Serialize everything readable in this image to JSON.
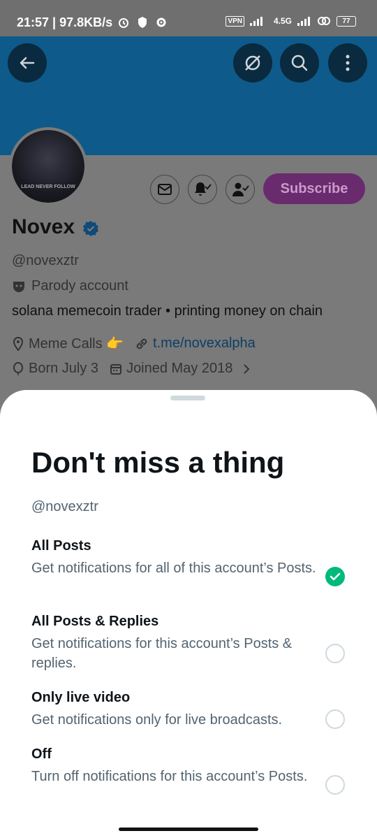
{
  "status_bar": {
    "time_speed": "21:57 | 97.8KB/s",
    "vpn": "VPN",
    "network": "4.5G",
    "battery": "77"
  },
  "header": {
    "icons": [
      "back-arrow-icon",
      "grok-icon",
      "search-icon",
      "more-icon"
    ]
  },
  "profile": {
    "name": "Novex",
    "handle": "@novexztr",
    "label": "Parody account",
    "bio": "solana memecoin trader • printing money on chain",
    "location": "Meme Calls 👉",
    "link": "t.me/novexalpha",
    "birthday": "Born July 3",
    "joined": "Joined May 2018",
    "subscribe": "Subscribe",
    "avatar_text": "LEAD NEVER FOLLOW"
  },
  "sheet": {
    "title": "Don't miss a thing",
    "handle": "@novexztr",
    "options": [
      {
        "title": "All Posts",
        "desc": "Get notifications for all of this account’s Posts.",
        "selected": true
      },
      {
        "title": "All Posts & Replies",
        "desc": "Get notifications for this account’s Posts & replies.",
        "selected": false
      },
      {
        "title": "Only live video",
        "desc": "Get notifications only for live broadcasts.",
        "selected": false
      },
      {
        "title": "Off",
        "desc": "Turn off notifications for this account’s Posts.",
        "selected": false
      }
    ]
  },
  "colors": {
    "accent": "#1d9bf0",
    "selected": "#00ba7c",
    "subscribe": "#8e3a96"
  }
}
